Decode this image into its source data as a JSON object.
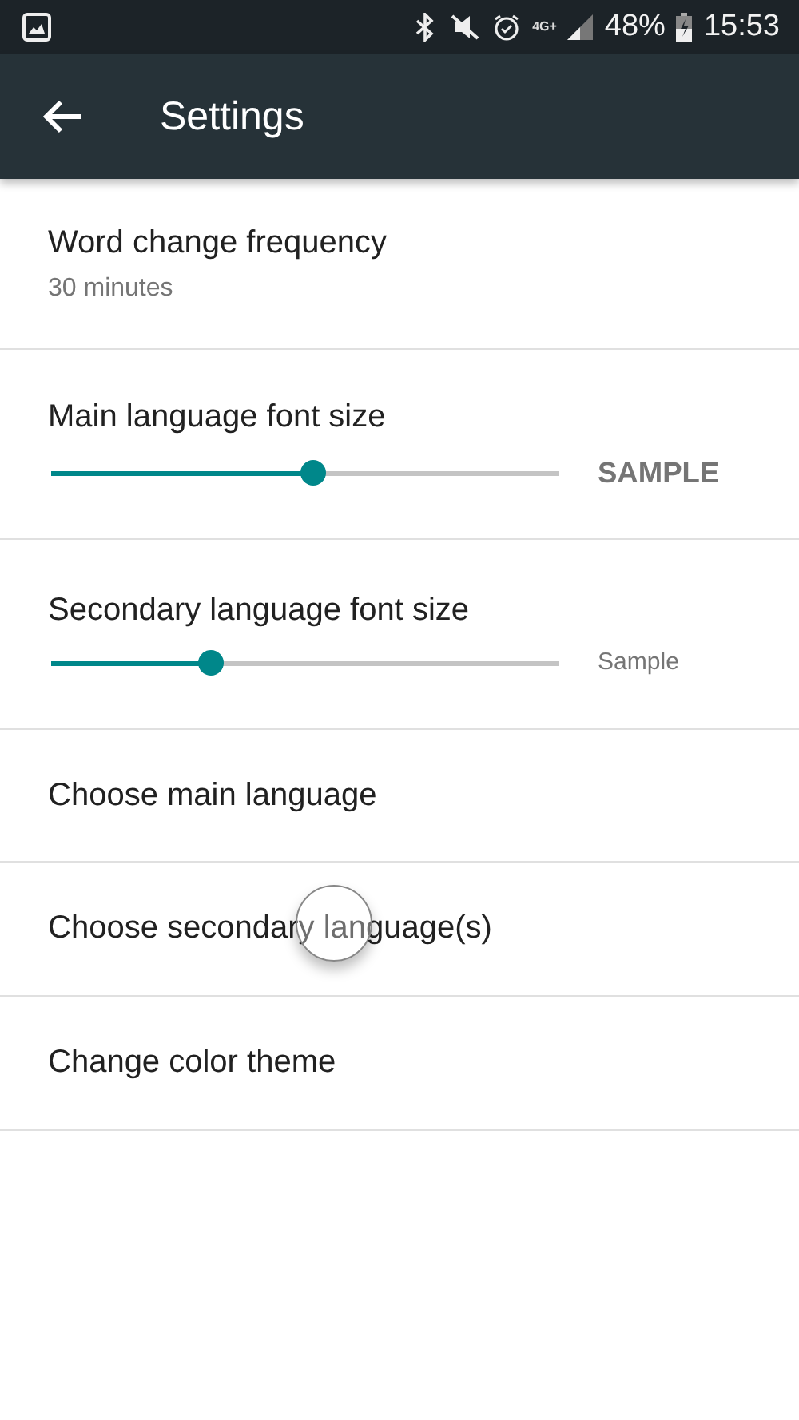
{
  "status_bar": {
    "network": "4G+",
    "battery": "48%",
    "time": "15:53"
  },
  "app_bar": {
    "title": "Settings"
  },
  "settings": [
    {
      "kind": "summary",
      "title": "Word change frequency",
      "summary": "30 minutes"
    },
    {
      "kind": "slider",
      "title": "Main language font size",
      "level": 0.517,
      "sample": "SAMPLE",
      "bold": true
    },
    {
      "kind": "slider",
      "title": "Secondary language font size",
      "level": 0.315,
      "sample": "Sample",
      "bold": false
    },
    {
      "kind": "plain",
      "title": "Choose main language"
    },
    {
      "kind": "plain",
      "title": "Choose secondary language(s)",
      "touched": true
    },
    {
      "kind": "plain",
      "title": "Change color theme"
    }
  ]
}
